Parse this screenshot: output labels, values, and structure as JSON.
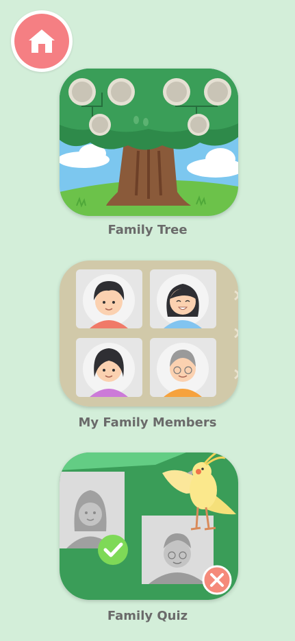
{
  "home": {
    "icon": "home-icon"
  },
  "menu": {
    "family_tree": {
      "label": "Family Tree",
      "image": "family-tree-illustration"
    },
    "family_members": {
      "label": "My Family Members",
      "image": "family-members-illustration"
    },
    "family_quiz": {
      "label": "Family Quiz",
      "image": "family-quiz-illustration"
    }
  },
  "colors": {
    "background": "#d3eed9",
    "home_button": "#f57f83",
    "label_text": "#6a6a6a",
    "quiz_correct": "#7ed957",
    "quiz_wrong": "#f58a7a"
  }
}
